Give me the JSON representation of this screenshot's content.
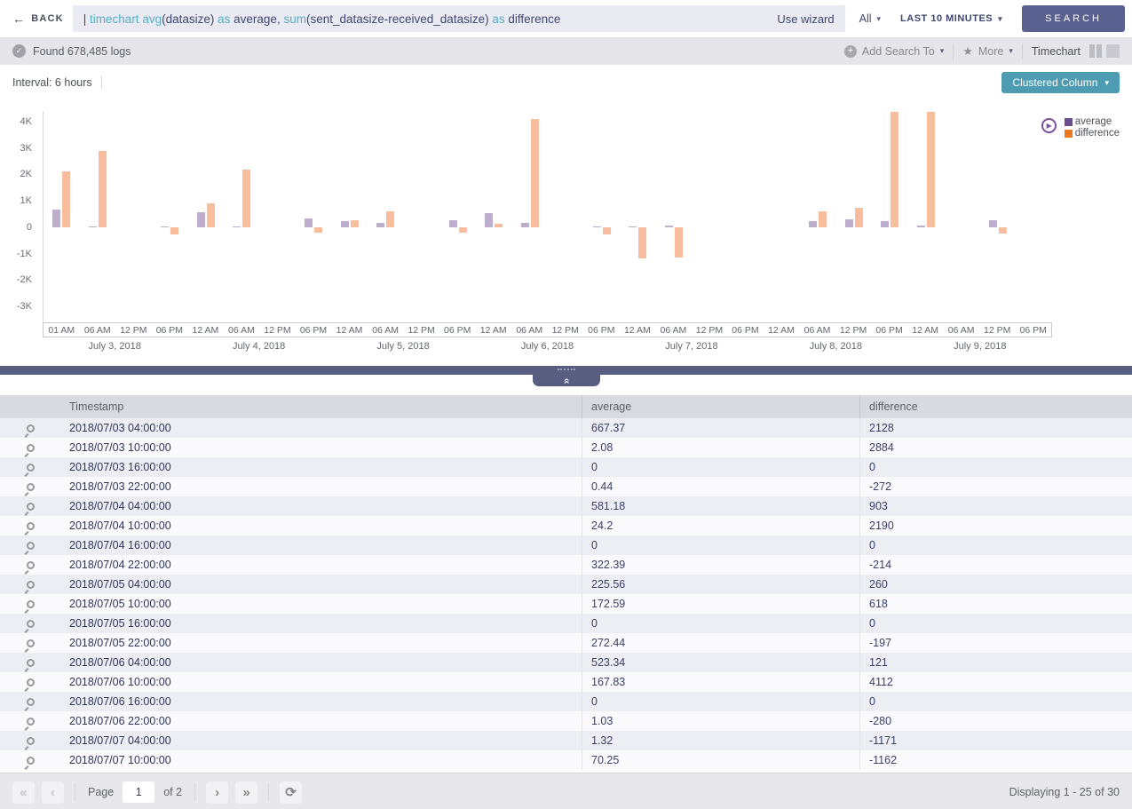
{
  "topbar": {
    "back_label": "BACK",
    "query_segments": [
      {
        "text": "| ",
        "type": "plain"
      },
      {
        "text": "timechart ",
        "type": "keyword"
      },
      {
        "text": "avg",
        "type": "keyword"
      },
      {
        "text": "(datasize) ",
        "type": "plain"
      },
      {
        "text": "as ",
        "type": "keyword"
      },
      {
        "text": "average, ",
        "type": "plain"
      },
      {
        "text": "sum",
        "type": "keyword"
      },
      {
        "text": "(sent_datasize-received_datasize) ",
        "type": "plain"
      },
      {
        "text": "as ",
        "type": "keyword"
      },
      {
        "text": "difference",
        "type": "plain"
      }
    ],
    "use_wizard_label": "Use wizard",
    "scope_dropdown": "All",
    "time_range_dropdown": "LAST 10 MINUTES",
    "search_button": "SEARCH"
  },
  "statusbar": {
    "found_text": "Found 678,485 logs",
    "add_search_to_label": "Add Search To",
    "more_label": "More",
    "view_label": "Timechart"
  },
  "chart_panel": {
    "interval_label": "Interval: 6 hours",
    "chart_type_button": "Clustered Column"
  },
  "chart_data": {
    "type": "bar",
    "title": "",
    "xlabel": "",
    "ylabel": "",
    "ylim": [
      -3600,
      4400
    ],
    "grid": false,
    "legend_position": "top-right",
    "y_ticks": [
      {
        "label": "4K",
        "value": 4000
      },
      {
        "label": "3K",
        "value": 3000
      },
      {
        "label": "2K",
        "value": 2000
      },
      {
        "label": "1K",
        "value": 1000
      },
      {
        "label": "0",
        "value": 0
      },
      {
        "label": "-1K",
        "value": -1000
      },
      {
        "label": "-2K",
        "value": -2000
      },
      {
        "label": "-3K",
        "value": -3000
      }
    ],
    "x": [
      "2018/07/03 04:00",
      "2018/07/03 10:00",
      "2018/07/03 16:00",
      "2018/07/03 22:00",
      "2018/07/04 04:00",
      "2018/07/04 10:00",
      "2018/07/04 16:00",
      "2018/07/04 22:00",
      "2018/07/05 04:00",
      "2018/07/05 10:00",
      "2018/07/05 16:00",
      "2018/07/05 22:00",
      "2018/07/06 04:00",
      "2018/07/06 10:00",
      "2018/07/06 16:00",
      "2018/07/06 22:00",
      "2018/07/07 04:00",
      "2018/07/07 10:00",
      "2018/07/07 16:00",
      "2018/07/07 22:00",
      "2018/07/08 04:00",
      "2018/07/08 10:00",
      "2018/07/08 16:00",
      "2018/07/08 22:00",
      "2018/07/09 04:00",
      "2018/07/09 10:00",
      "2018/07/09 16:00",
      "2018/07/09 22:00"
    ],
    "x_tick_labels": [
      "01 AM",
      "06 AM",
      "12 PM",
      "06 PM",
      "12 AM",
      "06 AM",
      "12 PM",
      "06 PM",
      "12 AM",
      "06 AM",
      "12 PM",
      "06 PM",
      "12 AM",
      "06 AM",
      "12 PM",
      "06 PM",
      "12 AM",
      "06 AM",
      "12 PM",
      "06 PM",
      "12 AM",
      "06 AM",
      "12 PM",
      "06 PM",
      "12 AM",
      "06 AM",
      "12 PM",
      "06 PM"
    ],
    "x_date_labels": [
      "July 3, 2018",
      "July 4, 2018",
      "July 5, 2018",
      "July 6, 2018",
      "July 7, 2018",
      "July 8, 2018",
      "July 9, 2018"
    ],
    "series": [
      {
        "name": "average",
        "bar_color": "#bdaecd",
        "legend_color": "#6b4e92",
        "values": [
          667.37,
          2.08,
          0,
          0.44,
          581.18,
          24.2,
          0,
          322.39,
          225.56,
          172.59,
          0,
          272.44,
          523.34,
          167.83,
          0,
          1.03,
          1.32,
          70.25,
          0,
          0,
          0,
          220,
          300,
          230,
          60,
          0,
          250,
          0
        ]
      },
      {
        "name": "difference",
        "bar_color": "#f7bd9d",
        "legend_color": "#ee7a20",
        "values": [
          2128,
          2884,
          0,
          -272,
          903,
          2190,
          0,
          -214,
          260,
          618,
          0,
          -197,
          121,
          4112,
          0,
          -280,
          -1171,
          -1162,
          0,
          0,
          0,
          600,
          750,
          4350,
          4350,
          0,
          -230,
          0
        ]
      }
    ]
  },
  "table": {
    "columns": [
      "Timestamp",
      "average",
      "difference"
    ],
    "rows": [
      {
        "ts": "2018/07/03 04:00:00",
        "avg": "667.37",
        "diff": "2128"
      },
      {
        "ts": "2018/07/03 10:00:00",
        "avg": "2.08",
        "diff": "2884"
      },
      {
        "ts": "2018/07/03 16:00:00",
        "avg": "0",
        "diff": "0"
      },
      {
        "ts": "2018/07/03 22:00:00",
        "avg": "0.44",
        "diff": "-272"
      },
      {
        "ts": "2018/07/04 04:00:00",
        "avg": "581.18",
        "diff": "903"
      },
      {
        "ts": "2018/07/04 10:00:00",
        "avg": "24.2",
        "diff": "2190"
      },
      {
        "ts": "2018/07/04 16:00:00",
        "avg": "0",
        "diff": "0"
      },
      {
        "ts": "2018/07/04 22:00:00",
        "avg": "322.39",
        "diff": "-214"
      },
      {
        "ts": "2018/07/05 04:00:00",
        "avg": "225.56",
        "diff": "260"
      },
      {
        "ts": "2018/07/05 10:00:00",
        "avg": "172.59",
        "diff": "618"
      },
      {
        "ts": "2018/07/05 16:00:00",
        "avg": "0",
        "diff": "0"
      },
      {
        "ts": "2018/07/05 22:00:00",
        "avg": "272.44",
        "diff": "-197"
      },
      {
        "ts": "2018/07/06 04:00:00",
        "avg": "523.34",
        "diff": "121"
      },
      {
        "ts": "2018/07/06 10:00:00",
        "avg": "167.83",
        "diff": "4112"
      },
      {
        "ts": "2018/07/06 16:00:00",
        "avg": "0",
        "diff": "0"
      },
      {
        "ts": "2018/07/06 22:00:00",
        "avg": "1.03",
        "diff": "-280"
      },
      {
        "ts": "2018/07/07 04:00:00",
        "avg": "1.32",
        "diff": "-1171"
      },
      {
        "ts": "2018/07/07 10:00:00",
        "avg": "70.25",
        "diff": "-1162"
      }
    ]
  },
  "footer": {
    "page_label": "Page",
    "page_value": "1",
    "of_label": "of 2",
    "displaying_text": "Displaying 1 - 25 of 30"
  }
}
